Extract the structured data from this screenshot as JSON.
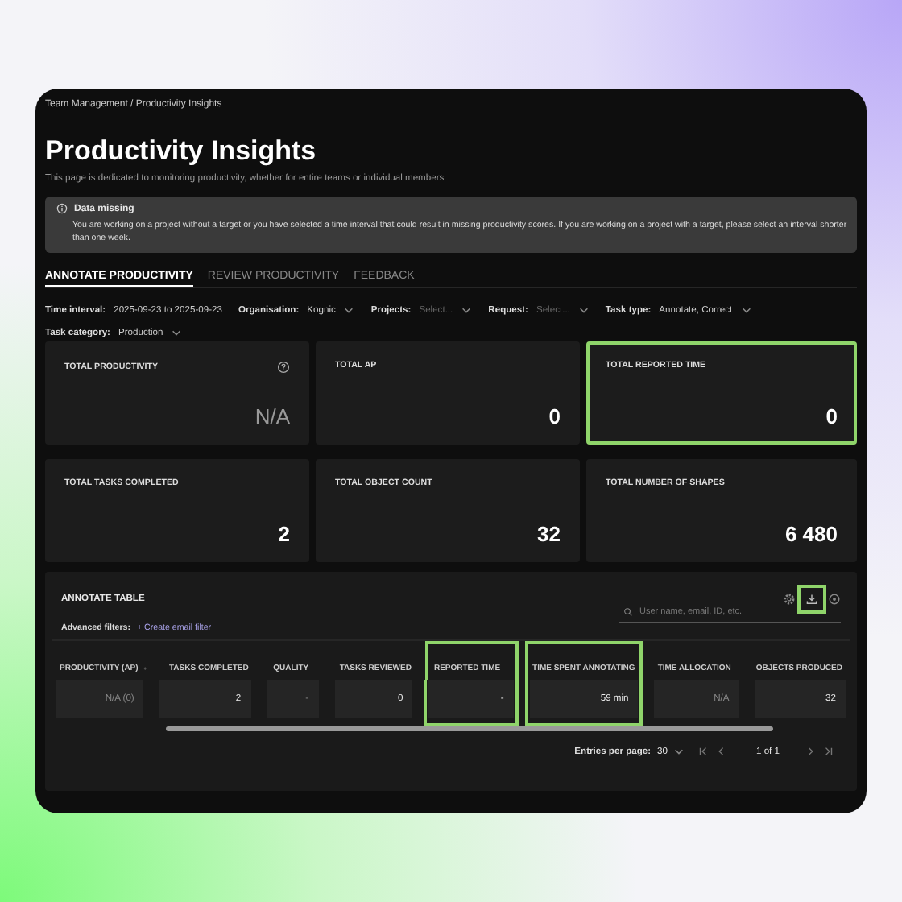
{
  "breadcrumb": "Team Management / Productivity Insights",
  "title": "Productivity Insights",
  "subtitle": "This page is dedicated to monitoring productivity, whether for entire teams or individual members",
  "alert": {
    "title": "Data missing",
    "text": "You are working on a project without a target or you have selected a time interval that could result in missing productivity scores. If you are working on a project with a target, please select an interval shorter than one week."
  },
  "tabs": [
    {
      "label": "ANNOTATE PRODUCTIVITY",
      "selected": true
    },
    {
      "label": "REVIEW PRODUCTIVITY",
      "selected": false
    },
    {
      "label": "FEEDBACK",
      "selected": false
    }
  ],
  "filters": [
    {
      "label": "Time interval:",
      "value": "2025-09-23 to 2025-09-23",
      "kind": "text"
    },
    {
      "label": "Organisation:",
      "value": "Kognic",
      "kind": "select"
    },
    {
      "label": "Projects:",
      "placeholder": "Select...",
      "kind": "select"
    },
    {
      "label": "Request:",
      "placeholder": "Select...",
      "kind": "select"
    },
    {
      "label": "Task type:",
      "value": "Annotate, Correct",
      "kind": "select"
    },
    {
      "label": "Task category:",
      "value": "Production",
      "kind": "select"
    }
  ],
  "cards": [
    {
      "title": "TOTAL PRODUCTIVITY",
      "value": "N/A",
      "muted": true,
      "help": true,
      "highlighted": false
    },
    {
      "title": "TOTAL AP",
      "value": "0",
      "muted": false,
      "help": false,
      "highlighted": false
    },
    {
      "title": "TOTAL REPORTED TIME",
      "value": "0",
      "muted": false,
      "help": false,
      "highlighted": true
    },
    {
      "title": "TOTAL TASKS COMPLETED",
      "value": "2",
      "muted": false,
      "help": false,
      "highlighted": false
    },
    {
      "title": "TOTAL OBJECT COUNT",
      "value": "32",
      "muted": false,
      "help": false,
      "highlighted": false
    },
    {
      "title": "TOTAL NUMBER OF SHAPES",
      "value": "6 480",
      "muted": false,
      "help": false,
      "highlighted": false
    }
  ],
  "table": {
    "title": "ANNOTATE TABLE",
    "download_highlighted": true,
    "search": {
      "placeholder": "User name, email, ID, etc."
    },
    "advanced_filters_label": "Advanced filters:",
    "create_filter_link": "+ Create email filter",
    "columns": [
      {
        "label": "PRODUCTIVITY (AP)",
        "sorted": true,
        "highlighted": false
      },
      {
        "label": "TASKS COMPLETED",
        "sorted": false,
        "highlighted": false
      },
      {
        "label": "QUALITY",
        "sorted": false,
        "highlighted": false
      },
      {
        "label": "TASKS REVIEWED",
        "sorted": false,
        "highlighted": false
      },
      {
        "label": "REPORTED TIME",
        "sorted": false,
        "highlighted": true
      },
      {
        "label": "TIME SPENT ANNOTATING",
        "sorted": false,
        "highlighted": true
      },
      {
        "label": "TIME ALLOCATION",
        "sorted": false,
        "highlighted": false
      },
      {
        "label": "OBJECTS PRODUCED",
        "sorted": false,
        "highlighted": false
      }
    ],
    "rows": [
      [
        {
          "text": "N/A  (0)",
          "muted": true
        },
        {
          "text": "2",
          "muted": false
        },
        {
          "text": "-",
          "muted": true
        },
        {
          "text": "0",
          "muted": false
        },
        {
          "text": "-",
          "muted": false
        },
        {
          "text": "59 min",
          "muted": false
        },
        {
          "text": "N/A",
          "muted": true
        },
        {
          "text": "32",
          "muted": false
        }
      ]
    ],
    "pagination": {
      "entries_label": "Entries per page:",
      "entries_value": "30",
      "page_text": "1 of 1"
    }
  }
}
